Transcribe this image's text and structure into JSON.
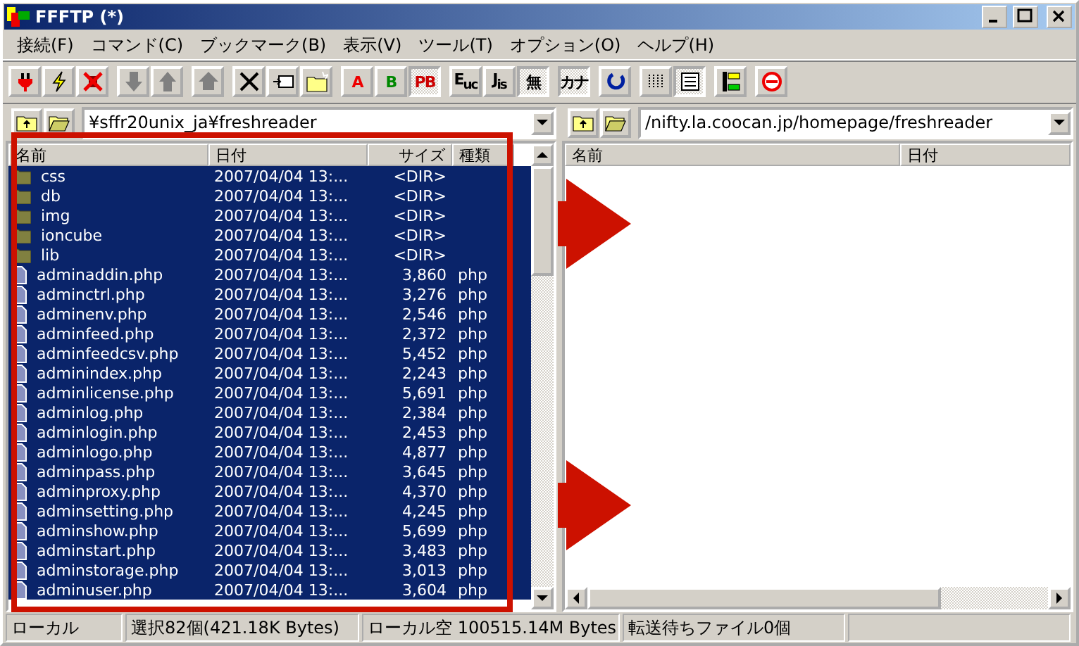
{
  "window": {
    "title": "FFFTP (*)"
  },
  "menu": [
    "接続(F)",
    "コマンド(C)",
    "ブックマーク(B)",
    "表示(V)",
    "ツール(T)",
    "オプション(O)",
    "ヘルプ(H)"
  ],
  "toolbar": [
    [
      {
        "kind": "icon",
        "pressed": false
      },
      {
        "kind": "icon",
        "pressed": false
      },
      {
        "kind": "icon",
        "pressed": false
      }
    ],
    [
      {
        "kind": "icon",
        "pressed": false
      },
      {
        "kind": "icon",
        "pressed": false
      }
    ],
    [
      {
        "kind": "icon",
        "pressed": false
      }
    ],
    [
      {
        "kind": "icon",
        "pressed": false
      },
      {
        "kind": "icon",
        "pressed": false
      },
      {
        "kind": "icon",
        "pressed": false
      }
    ],
    [
      {
        "kind": "text",
        "label": "A",
        "pressed": false
      },
      {
        "kind": "text",
        "label": "B",
        "pressed": false
      },
      {
        "kind": "text",
        "label": "PB",
        "pressed": true
      }
    ],
    [
      {
        "kind": "text",
        "label": "E$_{uc}$",
        "pressed": false
      },
      {
        "kind": "text",
        "label": "J$_{is}$",
        "pressed": false
      },
      {
        "kind": "text",
        "label": "無",
        "pressed": true
      }
    ],
    [
      {
        "kind": "text",
        "label": "カナ",
        "pressed": true
      }
    ],
    [
      {
        "kind": "icon",
        "pressed": false
      }
    ],
    [
      {
        "kind": "icon",
        "pressed": false
      },
      {
        "kind": "icon",
        "pressed": true
      }
    ],
    [
      {
        "kind": "icon",
        "pressed": false
      }
    ],
    [
      {
        "kind": "icon",
        "pressed": false
      }
    ]
  ],
  "local": {
    "path": "¥sffr20unix_ja¥freshreader",
    "columns": [
      "名前",
      "日付",
      "サイズ",
      "種類"
    ],
    "rows": [
      {
        "kind": "folder",
        "name": "css",
        "date": "2007/04/04 13:...",
        "size": "<DIR>",
        "type": "",
        "selected": true
      },
      {
        "kind": "folder",
        "name": "db",
        "date": "2007/04/04 13:...",
        "size": "<DIR>",
        "type": "",
        "selected": true
      },
      {
        "kind": "folder",
        "name": "img",
        "date": "2007/04/04 13:...",
        "size": "<DIR>",
        "type": "",
        "selected": true
      },
      {
        "kind": "folder",
        "name": "ioncube",
        "date": "2007/04/04 13:...",
        "size": "<DIR>",
        "type": "",
        "selected": true
      },
      {
        "kind": "folder",
        "name": "lib",
        "date": "2007/04/04 13:...",
        "size": "<DIR>",
        "type": "",
        "selected": true
      },
      {
        "kind": "file",
        "name": "adminaddin.php",
        "date": "2007/04/04 13:...",
        "size": "3,860",
        "type": "php",
        "selected": true
      },
      {
        "kind": "file",
        "name": "adminctrl.php",
        "date": "2007/04/04 13:...",
        "size": "3,276",
        "type": "php",
        "selected": true
      },
      {
        "kind": "file",
        "name": "adminenv.php",
        "date": "2007/04/04 13:...",
        "size": "2,546",
        "type": "php",
        "selected": true
      },
      {
        "kind": "file",
        "name": "adminfeed.php",
        "date": "2007/04/04 13:...",
        "size": "2,372",
        "type": "php",
        "selected": true
      },
      {
        "kind": "file",
        "name": "adminfeedcsv.php",
        "date": "2007/04/04 13:...",
        "size": "5,452",
        "type": "php",
        "selected": true
      },
      {
        "kind": "file",
        "name": "adminindex.php",
        "date": "2007/04/04 13:...",
        "size": "2,243",
        "type": "php",
        "selected": true
      },
      {
        "kind": "file",
        "name": "adminlicense.php",
        "date": "2007/04/04 13:...",
        "size": "5,691",
        "type": "php",
        "selected": true
      },
      {
        "kind": "file",
        "name": "adminlog.php",
        "date": "2007/04/04 13:...",
        "size": "2,384",
        "type": "php",
        "selected": true
      },
      {
        "kind": "file",
        "name": "adminlogin.php",
        "date": "2007/04/04 13:...",
        "size": "2,453",
        "type": "php",
        "selected": true
      },
      {
        "kind": "file",
        "name": "adminlogo.php",
        "date": "2007/04/04 13:...",
        "size": "4,877",
        "type": "php",
        "selected": true
      },
      {
        "kind": "file",
        "name": "adminpass.php",
        "date": "2007/04/04 13:...",
        "size": "3,645",
        "type": "php",
        "selected": true
      },
      {
        "kind": "file",
        "name": "adminproxy.php",
        "date": "2007/04/04 13:...",
        "size": "4,370",
        "type": "php",
        "selected": true
      },
      {
        "kind": "file",
        "name": "adminsetting.php",
        "date": "2007/04/04 13:...",
        "size": "4,245",
        "type": "php",
        "selected": true
      },
      {
        "kind": "file",
        "name": "adminshow.php",
        "date": "2007/04/04 13:...",
        "size": "5,699",
        "type": "php",
        "selected": true
      },
      {
        "kind": "file",
        "name": "adminstart.php",
        "date": "2007/04/04 13:...",
        "size": "3,483",
        "type": "php",
        "selected": true
      },
      {
        "kind": "file",
        "name": "adminstorage.php",
        "date": "2007/04/04 13:...",
        "size": "3,013",
        "type": "php",
        "selected": true
      },
      {
        "kind": "file",
        "name": "adminuser.php",
        "date": "2007/04/04 13:...",
        "size": "3,604",
        "type": "php",
        "selected": true
      }
    ]
  },
  "remote": {
    "path": "/nifty.la.coocan.jp/homepage/freshreader",
    "columns": [
      "名前",
      "日付"
    ]
  },
  "status_bar": [
    "ローカル",
    "選択82個(421.18K Bytes)",
    "ローカル空 100515.14M Bytes",
    "転送待ちファイル0個"
  ]
}
